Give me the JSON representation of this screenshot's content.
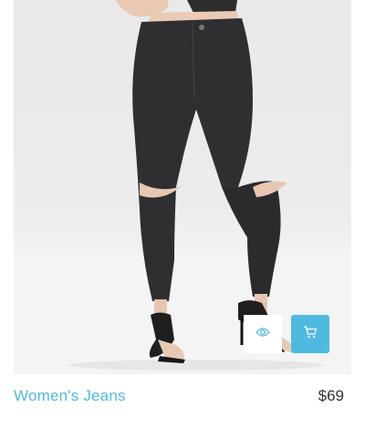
{
  "product": {
    "title": "Women's Jeans",
    "price": "$69",
    "image": "black high-waisted ripped-knee skinny jeans with black strappy sandals"
  },
  "actions": {
    "quick_view_icon": "eye-icon",
    "add_to_cart_icon": "cart-icon"
  },
  "colors": {
    "accent": "#4fbadf",
    "price_text": "#333333",
    "quick_view_bg": "#ffffff"
  }
}
